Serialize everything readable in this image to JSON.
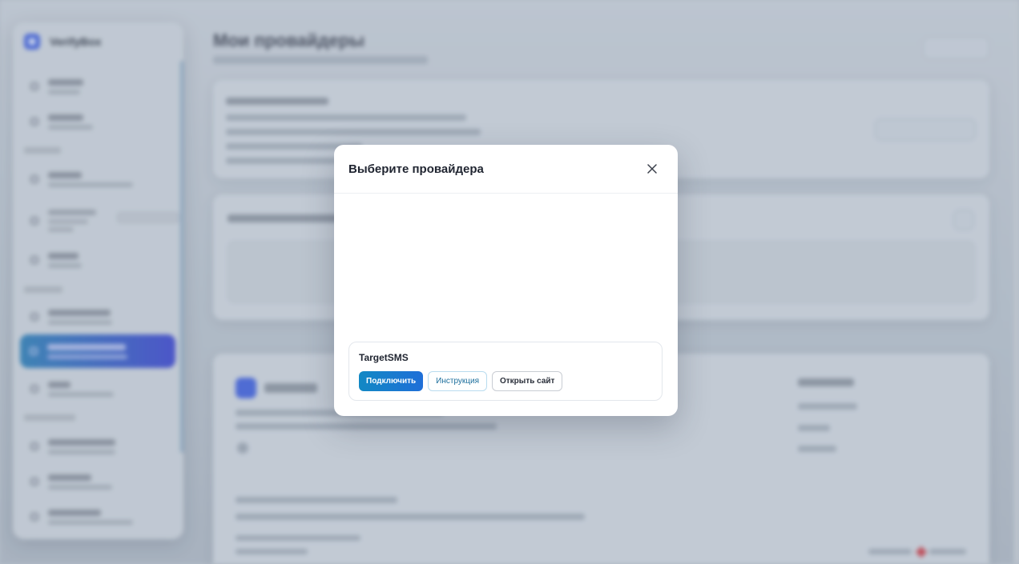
{
  "background": {
    "brand": "VerifyBox",
    "page_title": "Мои провайдеры"
  },
  "modal": {
    "title": "Выберите провайдера",
    "provider": {
      "name": "TargetSMS",
      "connect_label": "Подключить",
      "instruction_label": "Инструкция",
      "open_site_label": "Открыть сайт"
    }
  },
  "colors": {
    "primary": "#1288c4",
    "primary_end": "#1f6fd8",
    "instruction_text": "#1b6e9c"
  },
  "icons": {
    "close": "close-icon"
  }
}
